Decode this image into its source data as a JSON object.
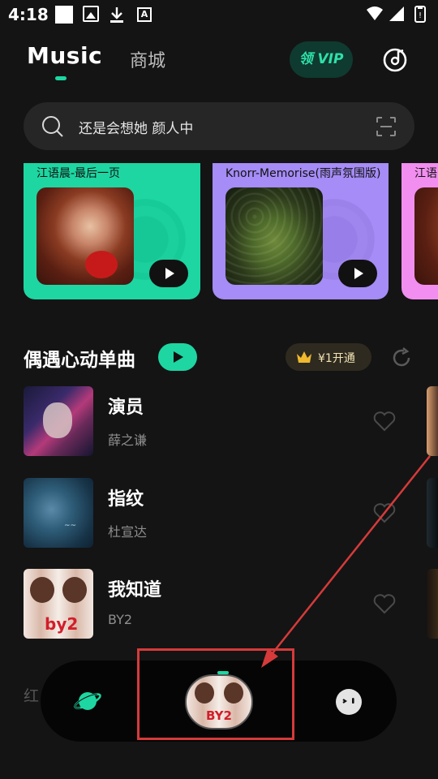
{
  "status_bar": {
    "time": "4:18",
    "left_icons": [
      "square-icon",
      "image-icon",
      "download-icon",
      "font-icon"
    ],
    "right_icons": [
      "wifi-icon",
      "signal-icon",
      "battery-icon"
    ]
  },
  "header": {
    "tabs": [
      {
        "label": "Music",
        "active": true
      },
      {
        "label": "商城",
        "active": false
      }
    ],
    "vip_button": "领 VIP",
    "record_icon": "record-icon"
  },
  "search": {
    "placeholder": "还是会想她 颜人中",
    "icon": "search-icon",
    "scan_icon": "scan-icon"
  },
  "banners": [
    {
      "title": "江语晨-最后一页",
      "bg": "#1ed6a2",
      "cover": "portrait-photo"
    },
    {
      "title": "Knorr-Memorise(雨声氛围版)",
      "bg": "#a58cf6",
      "cover": "rainy-window"
    },
    {
      "title": "江语",
      "bg": "#f28ef0",
      "cover": "portrait-photo"
    }
  ],
  "section": {
    "title": "偶遇心动单曲",
    "vip_pill": "¥1开通",
    "refresh_icon": "refresh-icon"
  },
  "songs": [
    {
      "title": "演员",
      "artist": "薛之谦"
    },
    {
      "title": "指纹",
      "artist": "杜宣达"
    },
    {
      "title": "我知道",
      "artist": "BY2"
    }
  ],
  "bottom": {
    "peek_text": "红",
    "nav_left_icon": "planet-icon",
    "nav_right_icon": "face-icon",
    "mini_player_cover": "BY2"
  },
  "colors": {
    "accent": "#1ed6a2",
    "background": "#141414",
    "annotation": "#d63a3a"
  }
}
